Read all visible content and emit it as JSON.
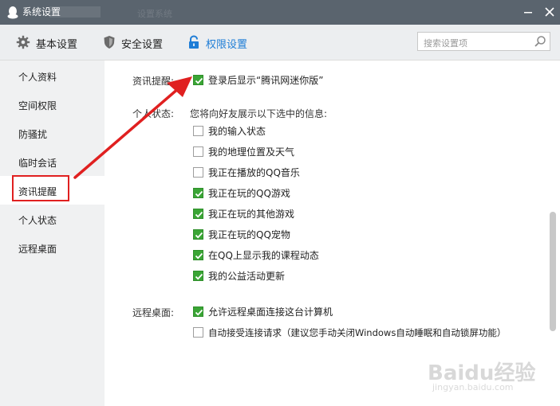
{
  "window": {
    "title": "系统设置",
    "faint_background_text": "设置系统"
  },
  "tabs": [
    {
      "label": "基本设置",
      "icon": "gear-icon",
      "active": false
    },
    {
      "label": "安全设置",
      "icon": "shield-icon",
      "active": false
    },
    {
      "label": "权限设置",
      "icon": "lock-icon",
      "active": true
    }
  ],
  "search": {
    "placeholder": "搜索设置项"
  },
  "sidebar": {
    "items": [
      {
        "label": "个人资料"
      },
      {
        "label": "空间权限"
      },
      {
        "label": "防骚扰"
      },
      {
        "label": "临时会话"
      },
      {
        "label": "资讯提醒",
        "active": true,
        "highlighted": true
      },
      {
        "label": "个人状态"
      },
      {
        "label": "远程桌面"
      }
    ]
  },
  "sections": {
    "news": {
      "label": "资讯提醒:",
      "options": [
        {
          "label": "登录后显示“腾讯网迷你版”",
          "checked": true
        }
      ]
    },
    "status": {
      "label": "个人状态:",
      "description": "您将向好友展示以下选中的信息:",
      "options": [
        {
          "label": "我的输入状态",
          "checked": false
        },
        {
          "label": "我的地理位置及天气",
          "checked": false
        },
        {
          "label": "我正在播放的QQ音乐",
          "checked": false
        },
        {
          "label": "我正在玩的QQ游戏",
          "checked": true
        },
        {
          "label": "我正在玩的其他游戏",
          "checked": true
        },
        {
          "label": "我正在玩的QQ宠物",
          "checked": true
        },
        {
          "label": "在QQ上显示我的课程动态",
          "checked": true
        },
        {
          "label": "我的公益活动更新",
          "checked": true
        }
      ]
    },
    "remote": {
      "label": "远程桌面:",
      "options": [
        {
          "label": "允许远程桌面连接这台计算机",
          "checked": true
        },
        {
          "label": "自动接受连接请求（建议您手动关闭Windows自动睡眠和自动锁屏功能）",
          "checked": false
        }
      ]
    }
  },
  "watermark": {
    "line1": "Baidu经验",
    "line2": "jingyan.baidu.com"
  },
  "colors": {
    "titlebar": "#5a646e",
    "accent": "#1e7dd6",
    "check_green": "#3aa535",
    "annotation_red": "#e02020"
  }
}
